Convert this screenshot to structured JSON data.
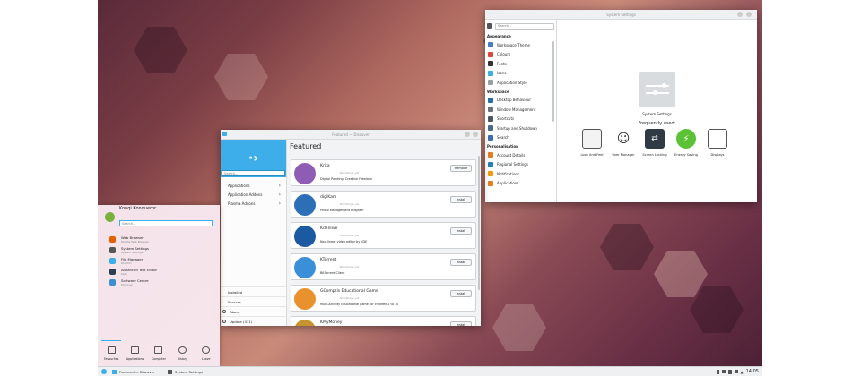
{
  "settings": {
    "window_title": "System Settings",
    "search_placeholder": "Search...",
    "sections": [
      {
        "title": "Appearance",
        "items": [
          {
            "label": "Workspace Theme",
            "color": "#4a7bc8"
          },
          {
            "label": "Colours",
            "color": "#e0443a"
          },
          {
            "label": "Fonts",
            "color": "#333333"
          },
          {
            "label": "Icons",
            "color": "#3daee9"
          },
          {
            "label": "Application Style",
            "color": "#9aa0a6"
          }
        ]
      },
      {
        "title": "Workspace",
        "items": [
          {
            "label": "Desktop Behaviour",
            "color": "#2b6cb0"
          },
          {
            "label": "Window Management",
            "color": "#6b7280"
          },
          {
            "label": "Shortcuts",
            "color": "#4b5563"
          },
          {
            "label": "Startup and Shutdown",
            "color": "#4b6a8a"
          },
          {
            "label": "Search",
            "color": "#3d6fb0"
          }
        ]
      },
      {
        "title": "Personalisation",
        "items": [
          {
            "label": "Account Details",
            "color": "#e67e22"
          },
          {
            "label": "Regional Settings",
            "color": "#2980b9"
          },
          {
            "label": "Notifications",
            "color": "#f39c12"
          },
          {
            "label": "Applications",
            "color": "#e67e22"
          }
        ]
      }
    ],
    "hero_label": "System Settings",
    "frequently_used_title": "Frequently used:",
    "frequent": [
      {
        "label": "Look And Feel",
        "icon": "look-and-feel-icon"
      },
      {
        "label": "User Manager",
        "icon": "user-manager-icon"
      },
      {
        "label": "Screen Locking",
        "icon": "screen-locking-icon"
      },
      {
        "label": "Energy Saving",
        "icon": "energy-saving-icon"
      },
      {
        "label": "Displays",
        "icon": "displays-icon"
      }
    ]
  },
  "discover": {
    "window_title": "Featured — Discover",
    "search_placeholder": "Search...",
    "nav": [
      {
        "label": "Applications"
      },
      {
        "label": "Application Addons"
      },
      {
        "label": "Plasma Addons"
      }
    ],
    "bottom_nav": [
      {
        "label": "Installed"
      },
      {
        "label": "Sources"
      },
      {
        "label": "About"
      },
      {
        "label": "Update (411)"
      }
    ],
    "heading": "Featured",
    "rating_text": "No ratings yet",
    "apps": [
      {
        "name": "Krita",
        "desc": "Digital Painting, Creative Freedom",
        "button": "Remove",
        "color": "#8e5bb5"
      },
      {
        "name": "digiKam",
        "desc": "Photo Management Program",
        "button": "Install",
        "color": "#2c6fb7"
      },
      {
        "name": "Kdenlive",
        "desc": "Non-linear video editor by KDE",
        "button": "Install",
        "color": "#1b5aa0"
      },
      {
        "name": "KTorrent",
        "desc": "BitTorrent Client",
        "button": "Install",
        "color": "#3b8ed8"
      },
      {
        "name": "GCompris Educational Game",
        "desc": "Multi-Activity Educational game for children 2 to 10",
        "button": "Install",
        "color": "#e8912d"
      },
      {
        "name": "KMyMoney",
        "desc": "",
        "button": "Install",
        "color": "#c7932f"
      }
    ]
  },
  "launcher": {
    "user_name": "Konqi Konqueror",
    "search_placeholder": "Search...",
    "favorites": [
      {
        "name": "Web Browser",
        "sub": "Mozilla Web Browser",
        "color": "#e66000"
      },
      {
        "name": "System Settings",
        "sub": "System Settings",
        "color": "#555555"
      },
      {
        "name": "File Manager",
        "sub": "Dolphin",
        "color": "#3daee9"
      },
      {
        "name": "Advanced Text Editor",
        "sub": "Kate",
        "color": "#2c3e50"
      },
      {
        "name": "Software Centre",
        "sub": "Discover",
        "color": "#3d8fd1"
      }
    ],
    "tabs": [
      {
        "label": "Favourites"
      },
      {
        "label": "Applications"
      },
      {
        "label": "Computer"
      },
      {
        "label": "History"
      },
      {
        "label": "Leave"
      }
    ]
  },
  "taskbar": {
    "tasks": [
      {
        "label": "Featured — Discover"
      },
      {
        "label": "System Settings"
      }
    ],
    "clock": "14:05"
  },
  "colors": {
    "accent": "#3daee9",
    "panel": "#eff0f1"
  }
}
